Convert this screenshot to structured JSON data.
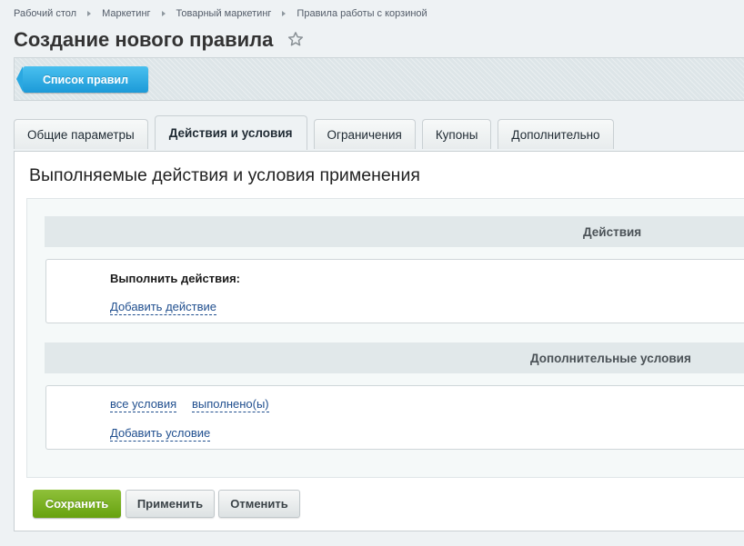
{
  "breadcrumb": {
    "items": [
      "Рабочий стол",
      "Маркетинг",
      "Товарный маркетинг",
      "Правила работы с корзиной"
    ]
  },
  "page": {
    "title": "Создание нового правила"
  },
  "toolbar": {
    "list_button": "Список правил"
  },
  "tabs": [
    {
      "label": "Общие параметры",
      "active": false
    },
    {
      "label": "Действия и условия",
      "active": true
    },
    {
      "label": "Ограничения",
      "active": false
    },
    {
      "label": "Купоны",
      "active": false
    },
    {
      "label": "Дополнительно",
      "active": false
    }
  ],
  "content": {
    "heading": "Выполняемые действия и условия применения",
    "actions_section": {
      "title": "Действия",
      "label": "Выполнить действия:",
      "add_link": "Добавить действие"
    },
    "conditions_section": {
      "title": "Дополнительные условия",
      "all_link": "все условия",
      "done_link": "выполнено(ы)",
      "add_link": "Добавить условие"
    }
  },
  "buttons": {
    "save": "Сохранить",
    "apply": "Применить",
    "cancel": "Отменить"
  },
  "colors": {
    "accent_blue": "#1c9ad8",
    "save_green": "#67a10f",
    "link": "#1f4e8e"
  },
  "icons": {
    "favorite": "star-outline-icon"
  }
}
